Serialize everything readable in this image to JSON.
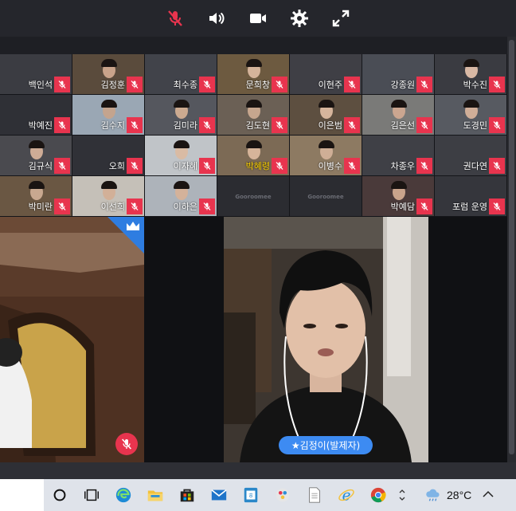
{
  "toolbar": {
    "buttons": [
      {
        "name": "mic-muted-icon",
        "active": false
      },
      {
        "name": "speaker-icon"
      },
      {
        "name": "camera-icon"
      },
      {
        "name": "settings-gear-icon"
      },
      {
        "name": "fullscreen-icon"
      }
    ],
    "accent_muted": "#e8344e"
  },
  "participants": [
    {
      "name": "백인석"
    },
    {
      "name": "김정훈"
    },
    {
      "name": "최수종"
    },
    {
      "name": "문희창"
    },
    {
      "name": "이현주"
    },
    {
      "name": "강종원"
    },
    {
      "name": "박수진"
    },
    {
      "name": "박예진"
    },
    {
      "name": "김수지"
    },
    {
      "name": "김미라"
    },
    {
      "name": "김도현"
    },
    {
      "name": "이은범"
    },
    {
      "name": "김은선"
    },
    {
      "name": "도경민"
    },
    {
      "name": "김규식"
    },
    {
      "name": "오희"
    },
    {
      "name": "이자혜"
    },
    {
      "name": "박혜령",
      "highlight": true
    },
    {
      "name": "이병수"
    },
    {
      "name": "차종우"
    },
    {
      "name": "권다연"
    },
    {
      "name": "박미란"
    },
    {
      "name": "이선희"
    },
    {
      "name": "이하은"
    },
    {
      "name": "",
      "logo": "Gooroomee"
    },
    {
      "name": "",
      "logo": "Gooroomee"
    },
    {
      "name": "박예담"
    },
    {
      "name": "포럼 운영"
    }
  ],
  "stage": {
    "presenter_label": "★김정이(발제자)"
  },
  "taskbar": {
    "weather_temp": "28°C",
    "apps": [
      "cortana-circle-icon",
      "task-view-icon",
      "edge-icon",
      "file-explorer-icon",
      "store-icon",
      "mail-icon",
      "hangul-icon",
      "paint-icon",
      "notepad-icon",
      "internet-explorer-icon",
      "chrome-icon"
    ]
  }
}
